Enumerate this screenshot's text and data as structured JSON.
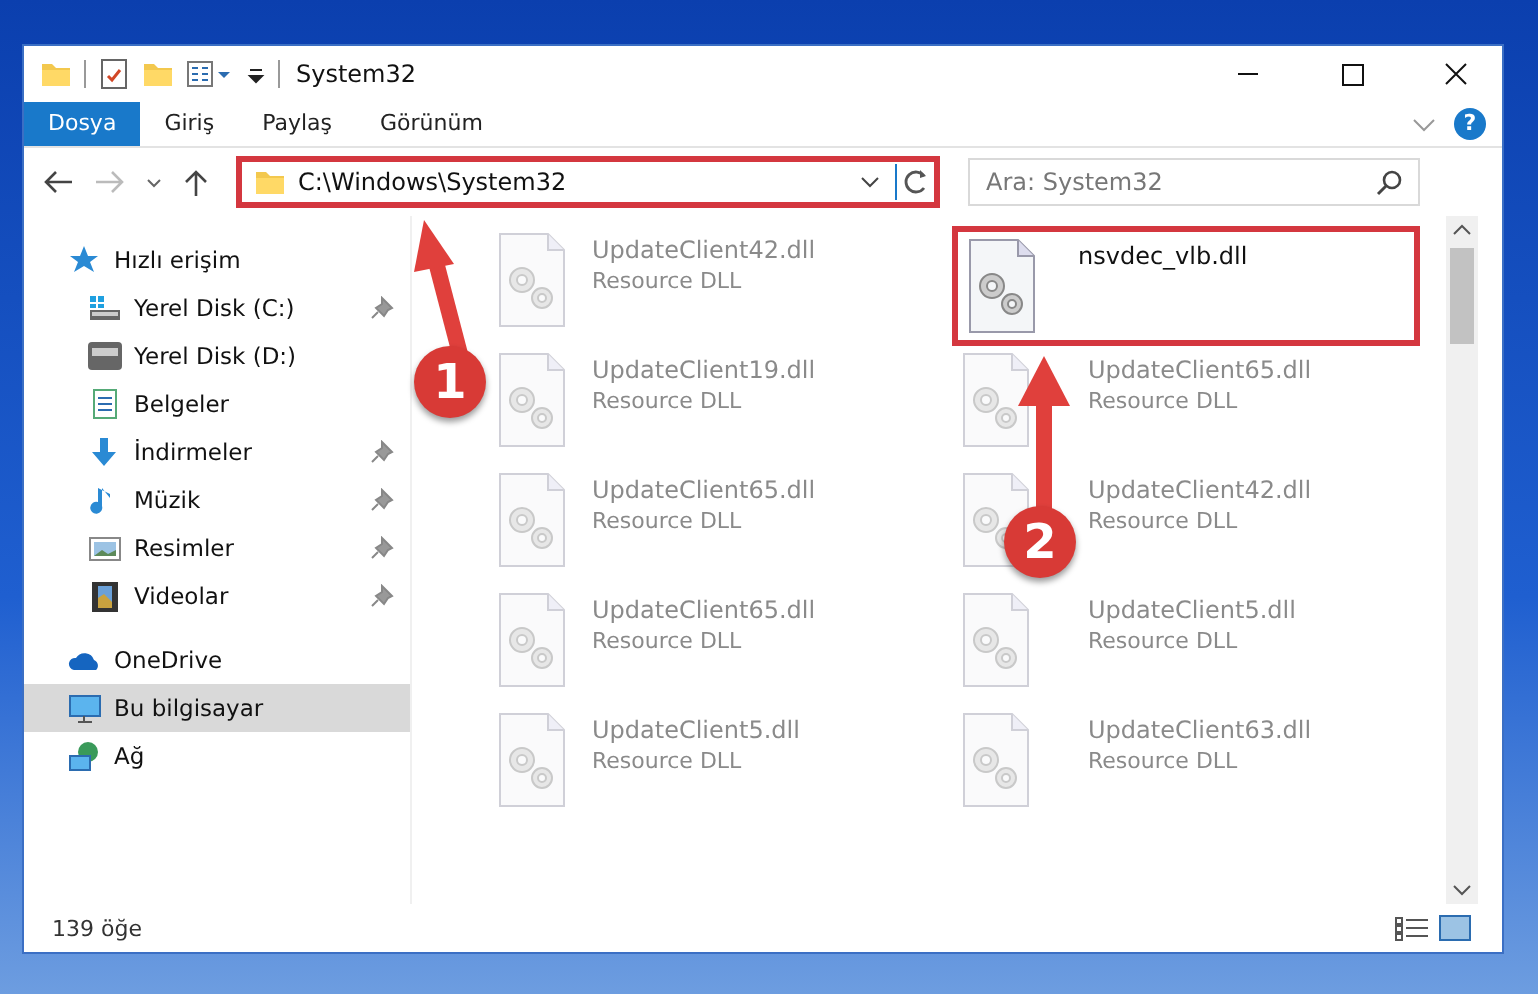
{
  "window": {
    "title": "System32"
  },
  "ribbon_tabs": [
    {
      "label": "Dosya",
      "selected": true
    },
    {
      "label": "Giriş",
      "selected": false
    },
    {
      "label": "Paylaş",
      "selected": false
    },
    {
      "label": "Görünüm",
      "selected": false
    }
  ],
  "help_button": "?",
  "address": {
    "path": "C:\\Windows\\System32",
    "highlighted": true
  },
  "search": {
    "placeholder": "Ara: System32"
  },
  "sidebar": [
    {
      "label": "Hızlı erişim",
      "kind": "star",
      "selected": false,
      "children": [
        {
          "label": "Yerel Disk (C:)",
          "kind": "drive-c",
          "pinned": true
        },
        {
          "label": "Yerel Disk (D:)",
          "kind": "drive",
          "pinned": false
        },
        {
          "label": "Belgeler",
          "kind": "document",
          "pinned": false
        },
        {
          "label": "İndirmeler",
          "kind": "download",
          "pinned": true
        },
        {
          "label": "Müzik",
          "kind": "music",
          "pinned": true
        },
        {
          "label": "Resimler",
          "kind": "pictures",
          "pinned": true
        },
        {
          "label": "Videolar",
          "kind": "video",
          "pinned": true
        }
      ]
    },
    {
      "label": "OneDrive",
      "kind": "cloud",
      "selected": false
    },
    {
      "label": "Bu bilgisayar",
      "kind": "computer",
      "selected": true
    },
    {
      "label": "Ağ",
      "kind": "network",
      "selected": false
    }
  ],
  "files": [
    {
      "name": "UpdateClient42.dll",
      "type": "Resource DLL",
      "dimmed": true,
      "highlighted": false
    },
    {
      "name": "nsvdec_vlb.dll",
      "dimmed": false,
      "highlighted": true
    },
    {
      "name": "UpdateClient19.dll",
      "type": "Resource DLL",
      "dimmed": true,
      "highlighted": false
    },
    {
      "name": "UpdateClient65.dll",
      "type": "Resource DLL",
      "dimmed": true,
      "highlighted": false
    },
    {
      "name": "UpdateClient65.dll",
      "type": "Resource DLL",
      "dimmed": true,
      "highlighted": false
    },
    {
      "name": "UpdateClient42.dll",
      "type": "Resource DLL",
      "dimmed": true,
      "highlighted": false
    },
    {
      "name": "UpdateClient65.dll",
      "type": "Resource DLL",
      "dimmed": true,
      "highlighted": false
    },
    {
      "name": "UpdateClient5.dll",
      "type": "Resource DLL",
      "dimmed": true,
      "highlighted": false
    },
    {
      "name": "UpdateClient5.dll",
      "type": "Resource DLL",
      "dimmed": true,
      "highlighted": false
    },
    {
      "name": "UpdateClient63.dll",
      "type": "Resource DLL",
      "dimmed": true,
      "highlighted": false
    }
  ],
  "annotations": [
    {
      "number": "1",
      "kind": "diagonal"
    },
    {
      "number": "2",
      "kind": "vertical"
    }
  ],
  "status_bar": {
    "count": "139 öğe"
  }
}
